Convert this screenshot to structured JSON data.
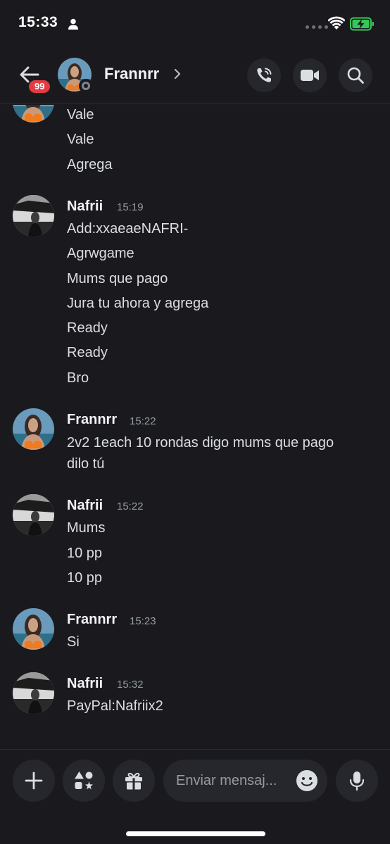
{
  "status_bar": {
    "time": "15:33",
    "icons": [
      "person-icon",
      "cellular-dots-icon",
      "wifi-icon",
      "battery-charging-icon"
    ],
    "battery_color": "#34c759"
  },
  "header": {
    "back_badge": "99",
    "channel_name": "Frannrr",
    "presence": "offline",
    "actions": [
      "phone-call-icon",
      "video-camera-icon",
      "search-icon"
    ]
  },
  "messages": {
    "group0": {
      "lines": [
        "Vale",
        "Vale",
        "Agrega"
      ]
    },
    "group1": {
      "author": "Nafrii",
      "time": "15:19",
      "lines": [
        "Add:xxaeaeNAFRI-",
        "Agrwgame",
        "Mums que pago",
        "Jura tu ahora y agrega",
        "Ready",
        "Ready",
        "Bro"
      ]
    },
    "group2": {
      "author": "Frannrr",
      "time": "15:22",
      "lines": [
        "2v2 1each 10 rondas digo mums que pago",
        "dilo tú"
      ]
    },
    "group3": {
      "author": "Nafrii",
      "time": "15:22",
      "lines": [
        "Mums",
        "10 pp",
        "10 pp"
      ]
    },
    "group4": {
      "author": "Frannrr",
      "time": "15:23",
      "lines": [
        "Si"
      ]
    },
    "group5": {
      "author": "Nafrii",
      "time": "15:32",
      "lines": [
        "PayPal:Nafriix2"
      ]
    }
  },
  "composer": {
    "placeholder": "Enviar mensaj...",
    "buttons": [
      "plus-icon",
      "apps-icon",
      "gift-icon",
      "emoji-icon",
      "microphone-icon"
    ]
  },
  "colors": {
    "background": "#1a1a1e",
    "button_bg": "#26272c",
    "badge_red": "#e23b43",
    "text_primary": "#f2f3f5",
    "text_muted": "#949ba4"
  }
}
